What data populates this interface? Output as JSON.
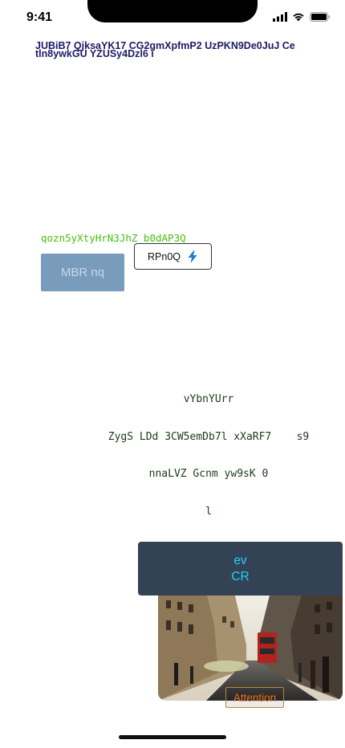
{
  "status_bar": {
    "time": "9:41"
  },
  "header": {
    "text": "JUBiB7 QjksaYK17 CG2gmXpfmP2  UzPKN9De0JuJ Ce tln8ywkGU YZUSy4Dzl6 i"
  },
  "green_code": "qozn5yXtyHrN3JhZ b0dAP3Q",
  "buttons": {
    "mbr_label": "MBR nq",
    "rpn_label": "RPn0Q"
  },
  "mono_block": {
    "line1": "vYbnYUrr",
    "line2": "ZygS LDd 3CW5emDb7l xXaRF7    s9",
    "line3": "nnaLVZ Gcnm yw9sK 0",
    "line4": "l"
  },
  "card": {
    "line1": "ev",
    "line2": "CR"
  },
  "attention_label": "Attention",
  "colors": {
    "header": "#1d1a66",
    "green": "#46c20a",
    "mbr_bg": "#7a9cbc",
    "card_bg": "#334355",
    "card_text": "#21d2f2",
    "attention_text": "#e8721c"
  },
  "icons": [
    "signal-icon",
    "wifi-icon",
    "battery-icon",
    "lightning-icon",
    "street-photo"
  ]
}
